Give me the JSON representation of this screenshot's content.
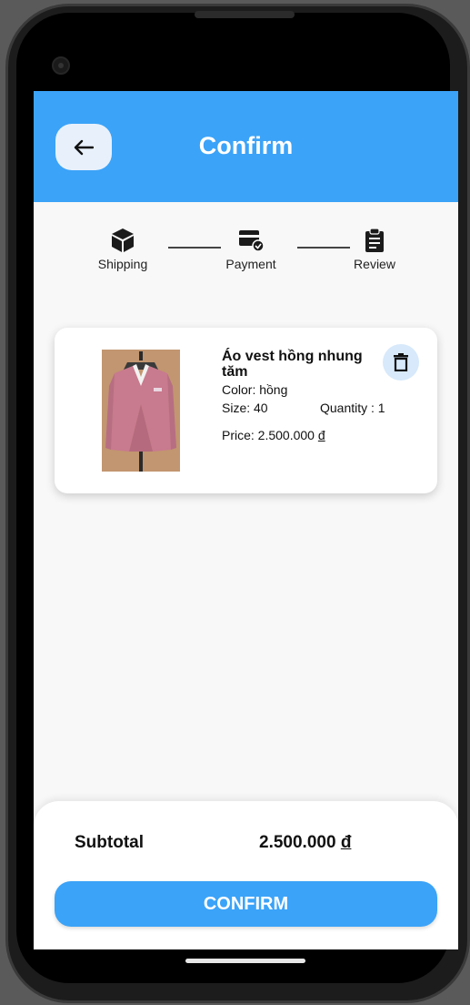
{
  "header": {
    "title": "Confirm",
    "back_icon": "arrow-left-icon"
  },
  "stepper": {
    "steps": [
      {
        "label": "Shipping",
        "icon": "box-icon"
      },
      {
        "label": "Payment",
        "icon": "credit-card-check-icon"
      },
      {
        "label": "Review",
        "icon": "clipboard-icon"
      }
    ]
  },
  "cart": {
    "items": [
      {
        "name": "Áo vest hồng nhung tăm",
        "color": "Color: hồng",
        "size": "Size: 40",
        "quantity": "Quantity : 1",
        "price_prefix": "Price: 2.500.000 ",
        "price_currency": "đ",
        "image": "pink-suit-jacket-image"
      }
    ]
  },
  "summary": {
    "subtotal_label": "Subtotal",
    "subtotal_amount": "2.500.000 ",
    "subtotal_currency": "đ"
  },
  "actions": {
    "confirm_label": "CONFIRM"
  },
  "colors": {
    "primary": "#3ba3f8",
    "background": "#f8f8f8",
    "card": "#ffffff"
  }
}
